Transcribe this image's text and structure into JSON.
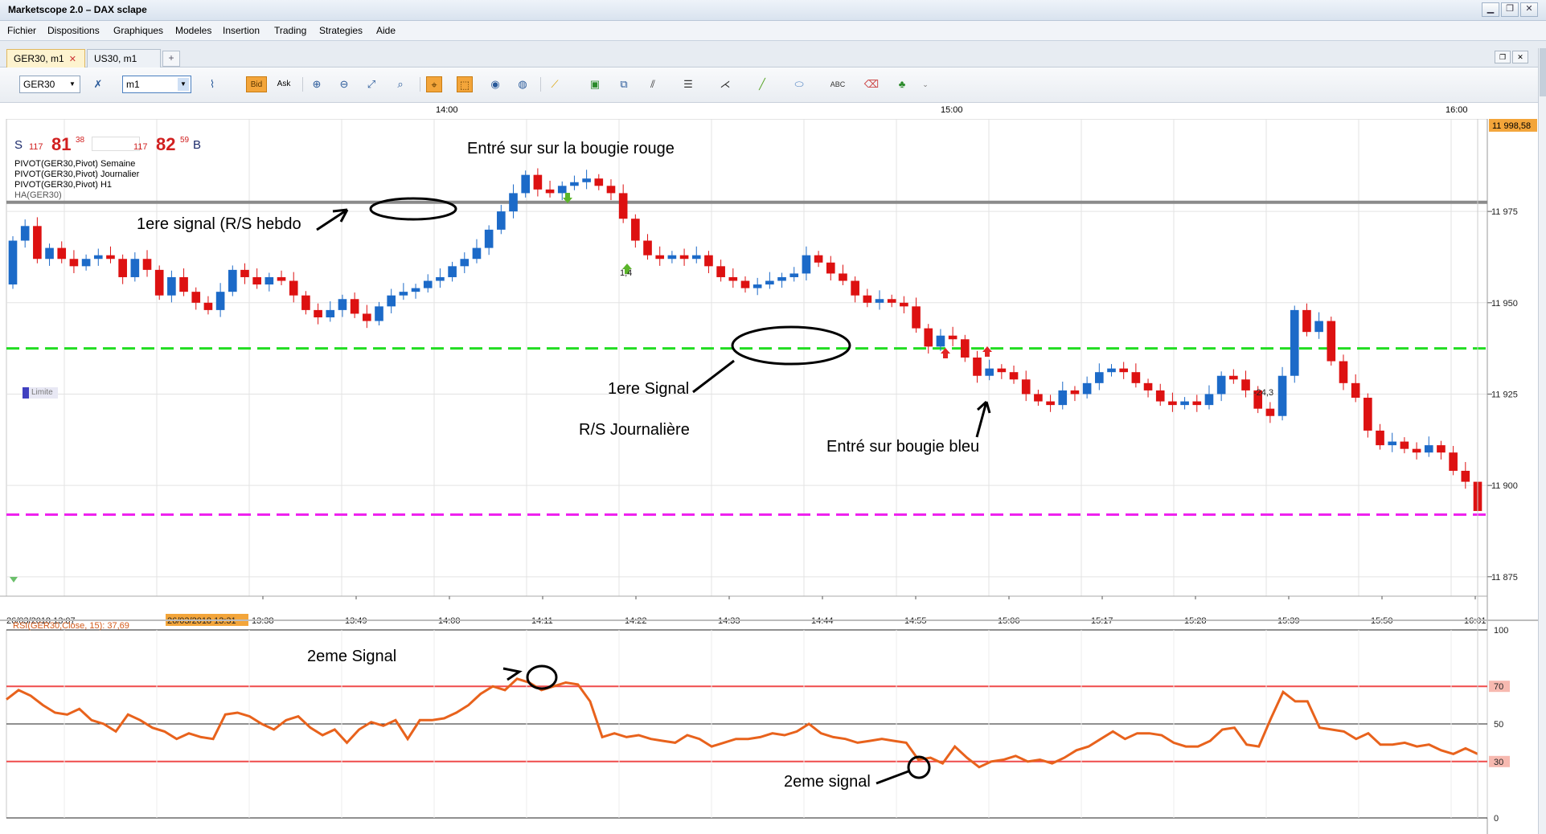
{
  "window": {
    "title": "Marketscope 2.0 – DAX sclape"
  },
  "menu": [
    "Fichier",
    "Dispositions",
    "Graphiques",
    "Modeles",
    "Insertion",
    "Trading",
    "Strategies",
    "Aide"
  ],
  "tabs": [
    {
      "label": "GER30, m1",
      "active": true
    },
    {
      "label": "US30, m1",
      "active": false
    }
  ],
  "toolbar": {
    "instrument": "GER30",
    "timeframe": "m1",
    "bid_label": "Bid",
    "ask_label": "Ask"
  },
  "top_time_labels": [
    "14:00",
    "15:00",
    "16:00"
  ],
  "quote": {
    "sell_letter": "S",
    "sell_small": "117",
    "sell_big": "81",
    "sell_sup": "38",
    "buy_small": "117",
    "buy_big": "82",
    "buy_sup": "59",
    "buy_letter": "B"
  },
  "indicators": [
    "PIVOT(GER30,Pivot) Semaine",
    "PIVOT(GER30,Pivot) Journalier",
    "PIVOT(GER30,Pivot) H1",
    "HA(GER30)"
  ],
  "limit_label": "Limite",
  "marker_labels": {
    "green_marker": "1,4",
    "red_marker": "-24,3"
  },
  "annotations": {
    "top_text": "Entré sur sur la bougie rouge",
    "weekly": "1ere signal (R/S hebdo",
    "first_signal": "1ere Signal",
    "daily": "R/S Journalière",
    "blue_entry": "Entré sur bougie bleu",
    "rsi_signal_top": "2eme Signal",
    "rsi_signal_bottom": "2eme signal"
  },
  "x_axis": {
    "start_label": "26/03/2018 13:07",
    "highlight_label": "26/03/2018 13:31",
    "labels": [
      "13:38",
      "13:49",
      "14:00",
      "14:11",
      "14:22",
      "14:33",
      "14:44",
      "14:55",
      "15:06",
      "15:17",
      "15:28",
      "15:39",
      "15:50",
      "16:01"
    ]
  },
  "price_axis": {
    "current": "11 998,58",
    "labels": [
      "11 975",
      "11 950",
      "11 925",
      "11 900",
      "11 875"
    ]
  },
  "rsi": {
    "title": "RSI(GER30,Close, 15): 37,69",
    "labels": [
      "100",
      "70",
      "50",
      "30",
      "0"
    ]
  },
  "colors": {
    "bull": "#1c6ac8",
    "bear": "#dd1111",
    "weekly_line": "#8a8a8a",
    "daily_line": "#22dd22",
    "magenta_line": "#ee22ee",
    "rsi_line": "#e8621c",
    "rsi_bands": "#ef4b4b",
    "highlight": "#f3a53a"
  },
  "chart_data": {
    "type": "candlestick",
    "price_levels": {
      "weekly_pivot": 11977.5,
      "daily_pivot": 11937.5,
      "magenta_level": 11892
    },
    "price_range": [
      11871,
      11999
    ],
    "candles": [
      [
        11955,
        11967
      ],
      [
        11967,
        11971
      ],
      [
        11971,
        11962
      ],
      [
        11962,
        11965
      ],
      [
        11965,
        11962
      ],
      [
        11962,
        11960
      ],
      [
        11960,
        11962
      ],
      [
        11962,
        11963
      ],
      [
        11963,
        11962
      ],
      [
        11962,
        11957
      ],
      [
        11957,
        11962
      ],
      [
        11962,
        11959
      ],
      [
        11959,
        11952
      ],
      [
        11952,
        11957
      ],
      [
        11957,
        11953
      ],
      [
        11953,
        11950
      ],
      [
        11950,
        11948
      ],
      [
        11948,
        11953
      ],
      [
        11953,
        11959
      ],
      [
        11959,
        11957
      ],
      [
        11957,
        11955
      ],
      [
        11955,
        11957
      ],
      [
        11957,
        11956
      ],
      [
        11956,
        11952
      ],
      [
        11952,
        11948
      ],
      [
        11948,
        11946
      ],
      [
        11946,
        11948
      ],
      [
        11948,
        11951
      ],
      [
        11951,
        11947
      ],
      [
        11947,
        11945
      ],
      [
        11945,
        11949
      ],
      [
        11949,
        11952
      ],
      [
        11952,
        11953
      ],
      [
        11953,
        11954
      ],
      [
        11954,
        11956
      ],
      [
        11956,
        11957
      ],
      [
        11957,
        11960
      ],
      [
        11960,
        11962
      ],
      [
        11962,
        11965
      ],
      [
        11965,
        11970
      ],
      [
        11970,
        11975
      ],
      [
        11975,
        11980
      ],
      [
        11980,
        11985
      ],
      [
        11985,
        11981
      ],
      [
        11981,
        11980
      ],
      [
        11980,
        11982
      ],
      [
        11982,
        11983
      ],
      [
        11983,
        11984
      ],
      [
        11984,
        11982
      ],
      [
        11982,
        11980
      ],
      [
        11980,
        11973
      ],
      [
        11973,
        11967
      ],
      [
        11967,
        11963
      ],
      [
        11963,
        11962
      ],
      [
        11962,
        11963
      ],
      [
        11963,
        11962
      ],
      [
        11962,
        11963
      ],
      [
        11963,
        11960
      ],
      [
        11960,
        11957
      ],
      [
        11957,
        11956
      ],
      [
        11956,
        11954
      ],
      [
        11954,
        11955
      ],
      [
        11955,
        11956
      ],
      [
        11956,
        11957
      ],
      [
        11957,
        11958
      ],
      [
        11958,
        11963
      ],
      [
        11963,
        11961
      ],
      [
        11961,
        11958
      ],
      [
        11958,
        11956
      ],
      [
        11956,
        11952
      ],
      [
        11952,
        11950
      ],
      [
        11950,
        11951
      ],
      [
        11951,
        11950
      ],
      [
        11950,
        11949
      ],
      [
        11949,
        11943
      ],
      [
        11943,
        11938
      ],
      [
        11938,
        11941
      ],
      [
        11941,
        11940
      ],
      [
        11940,
        11935
      ],
      [
        11935,
        11930
      ],
      [
        11930,
        11932
      ],
      [
        11932,
        11931
      ],
      [
        11931,
        11929
      ],
      [
        11929,
        11925
      ],
      [
        11925,
        11923
      ],
      [
        11923,
        11922
      ],
      [
        11922,
        11926
      ],
      [
        11926,
        11925
      ],
      [
        11925,
        11928
      ],
      [
        11928,
        11931
      ],
      [
        11931,
        11932
      ],
      [
        11932,
        11931
      ],
      [
        11931,
        11928
      ],
      [
        11928,
        11926
      ],
      [
        11926,
        11923
      ],
      [
        11923,
        11922
      ],
      [
        11922,
        11923
      ],
      [
        11923,
        11922
      ],
      [
        11922,
        11925
      ],
      [
        11925,
        11930
      ],
      [
        11930,
        11929
      ],
      [
        11929,
        11926
      ],
      [
        11926,
        11921
      ],
      [
        11921,
        11919
      ],
      [
        11919,
        11930
      ],
      [
        11930,
        11948
      ],
      [
        11948,
        11942
      ],
      [
        11942,
        11945
      ],
      [
        11945,
        11934
      ],
      [
        11934,
        11928
      ],
      [
        11928,
        11924
      ],
      [
        11924,
        11915
      ],
      [
        11915,
        11911
      ],
      [
        11911,
        11912
      ],
      [
        11912,
        11910
      ],
      [
        11910,
        11909
      ],
      [
        11909,
        11911
      ],
      [
        11911,
        11909
      ],
      [
        11909,
        11904
      ],
      [
        11904,
        11901
      ],
      [
        11901,
        11893
      ]
    ],
    "rsi_values": [
      63,
      68,
      65,
      60,
      56,
      55,
      58,
      52,
      50,
      46,
      55,
      52,
      48,
      46,
      42,
      45,
      43,
      42,
      55,
      56,
      54,
      50,
      47,
      52,
      54,
      48,
      44,
      47,
      40,
      47,
      51,
      49,
      52,
      42,
      52,
      52,
      53,
      56,
      60,
      66,
      70,
      68,
      74,
      72,
      68,
      70,
      72,
      71,
      62,
      43,
      45,
      43,
      44,
      42,
      41,
      40,
      44,
      42,
      38,
      40,
      42,
      42,
      43,
      45,
      44,
      46,
      50,
      45,
      43,
      42,
      40,
      41,
      42,
      41,
      40,
      31,
      32,
      29,
      38,
      32,
      27,
      30,
      31,
      33,
      30,
      31,
      29,
      32,
      36,
      38,
      42,
      46,
      42,
      45,
      45,
      44,
      40,
      38,
      38,
      41,
      47,
      48,
      39,
      38,
      53,
      67,
      62,
      62,
      48,
      47,
      46,
      42,
      45,
      39,
      39,
      40,
      38,
      39,
      36,
      34,
      37,
      34
    ]
  }
}
